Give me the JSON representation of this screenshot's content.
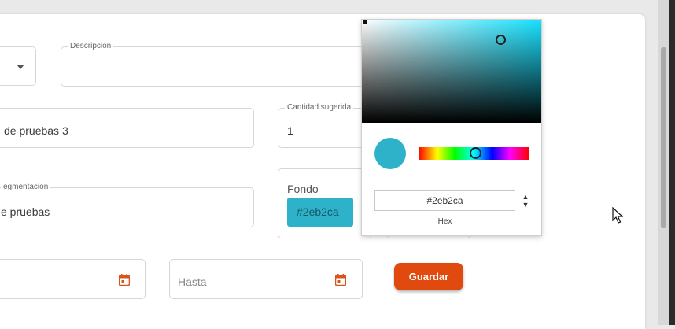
{
  "form": {
    "descripcion": {
      "label": "Descripción",
      "value": ""
    },
    "nombre": {
      "value": "de pruebas 3"
    },
    "cantidad": {
      "label": "Cantidad sugerida",
      "value": "1"
    },
    "segmentacion": {
      "label": "egmentacion",
      "value": "e pruebas"
    },
    "fondo": {
      "label": "Fondo",
      "value": "#2eb2ca"
    },
    "hasta": {
      "placeholder": "Hasta"
    },
    "guardar_label": "Guardar"
  },
  "picker": {
    "hex_value": "#2eb2ca",
    "hex_label": "Hex",
    "toggle_glyph": "▲▼",
    "hue_color": "#17e1ff"
  },
  "colors": {
    "accent": "#e04a0e",
    "fondo_swatch": "#2eb2ca",
    "icon": "#d9541a"
  },
  "icons": [
    "chevron-down-icon",
    "calendar-icon",
    "mouse-pointer-icon"
  ]
}
